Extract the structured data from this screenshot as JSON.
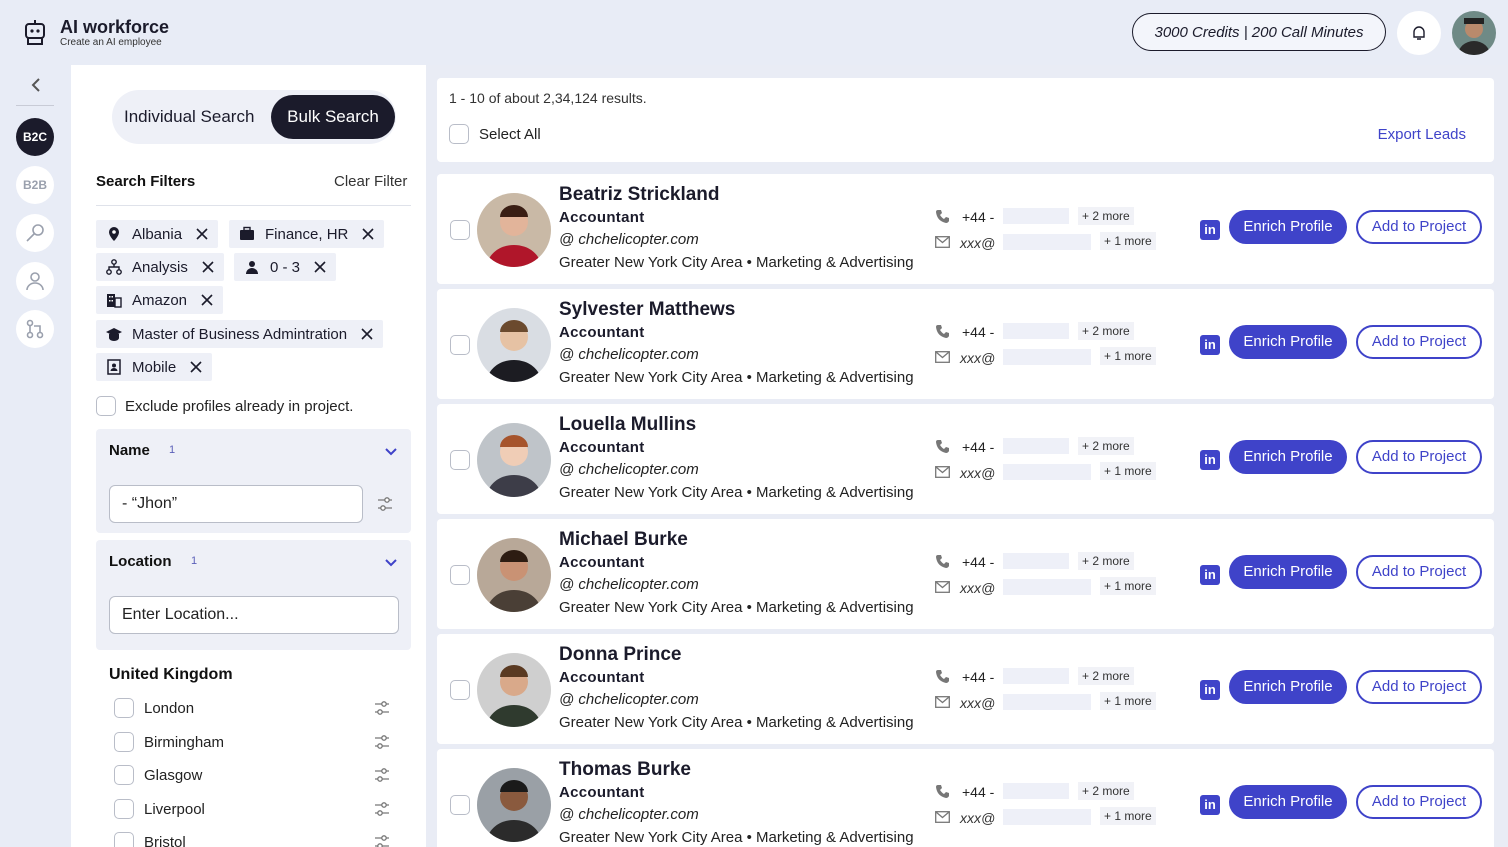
{
  "app": {
    "title": "AI workforce",
    "subtitle": "Create an AI employee"
  },
  "header": {
    "credits": "3000 Credits  | 200 Call Minutes"
  },
  "rail": {
    "items": [
      {
        "label": "B2C"
      },
      {
        "label": "B2B"
      }
    ]
  },
  "filters": {
    "tab_individual": "Individual Search",
    "tab_bulk": "Bulk Search",
    "title": "Search Filters",
    "clear": "Clear Filter",
    "chips": [
      {
        "label": "Albania",
        "icon": "location-pin-icon"
      },
      {
        "label": "Finance, HR",
        "icon": "briefcase-icon"
      },
      {
        "label": "Analysis",
        "icon": "hierarchy-icon"
      },
      {
        "label": "0 - 3",
        "icon": "person-icon"
      },
      {
        "label": "Amazon",
        "icon": "building-icon"
      },
      {
        "label": "Master of Business Admintration",
        "icon": "graduation-cap-icon"
      },
      {
        "label": "Mobile",
        "icon": "contact-card-icon"
      }
    ],
    "exclude_label": "Exclude profiles already in project.",
    "name_section": {
      "title": "Name",
      "count": "1",
      "value": "- “Jhon”"
    },
    "location_section": {
      "title": "Location",
      "count": "1",
      "placeholder": "Enter Location..."
    },
    "country": "United Kingdom",
    "cities": [
      "London",
      "Birmingham",
      "Glasgow",
      "Liverpool",
      "Bristol"
    ]
  },
  "results": {
    "count_text": "1 - 10 of about 2,34,124 results.",
    "select_all": "Select All",
    "export": "Export Leads",
    "items": [
      {
        "name": "Beatriz Strickland",
        "title": "Accountant",
        "domain": "@ chchelicopter.com",
        "location": "Greater New York City Area • Marketing & Advertising",
        "phone": "+44 -",
        "email": "xxx@",
        "phone_more": "+ 2 more",
        "email_more": "+ 1 more"
      },
      {
        "name": "Sylvester Matthews",
        "title": "Accountant",
        "domain": "@ chchelicopter.com",
        "location": "Greater New York City Area • Marketing & Advertising",
        "phone": "+44 -",
        "email": "xxx@",
        "phone_more": "+ 2 more",
        "email_more": "+ 1 more"
      },
      {
        "name": "Louella Mullins",
        "title": "Accountant",
        "domain": "@ chchelicopter.com",
        "location": "Greater New York City Area • Marketing & Advertising",
        "phone": "+44 -",
        "email": "xxx@",
        "phone_more": "+ 2 more",
        "email_more": "+ 1 more"
      },
      {
        "name": "Michael Burke",
        "title": "Accountant",
        "domain": "@ chchelicopter.com",
        "location": "Greater New York City Area • Marketing & Advertising",
        "phone": "+44 -",
        "email": "xxx@",
        "phone_more": "+ 2 more",
        "email_more": "+ 1 more"
      },
      {
        "name": "Donna Prince",
        "title": "Accountant",
        "domain": "@ chchelicopter.com",
        "location": "Greater New York City Area • Marketing & Advertising",
        "phone": "+44 -",
        "email": "xxx@",
        "phone_more": "+ 2 more",
        "email_more": "+ 1 more"
      },
      {
        "name": "Thomas Burke",
        "title": "Accountant",
        "domain": "@ chchelicopter.com",
        "location": "Greater New York City Area • Marketing & Advertising",
        "phone": "+44 -",
        "email": "xxx@",
        "phone_more": "+ 2 more",
        "email_more": "+ 1 more"
      }
    ],
    "linkedin": "in",
    "enrich_label": "Enrich Profile",
    "add_label": "Add to Project"
  },
  "colors": {
    "accent": "#3f43c9",
    "dark": "#1b1b2b",
    "panel": "#eef0f7"
  }
}
